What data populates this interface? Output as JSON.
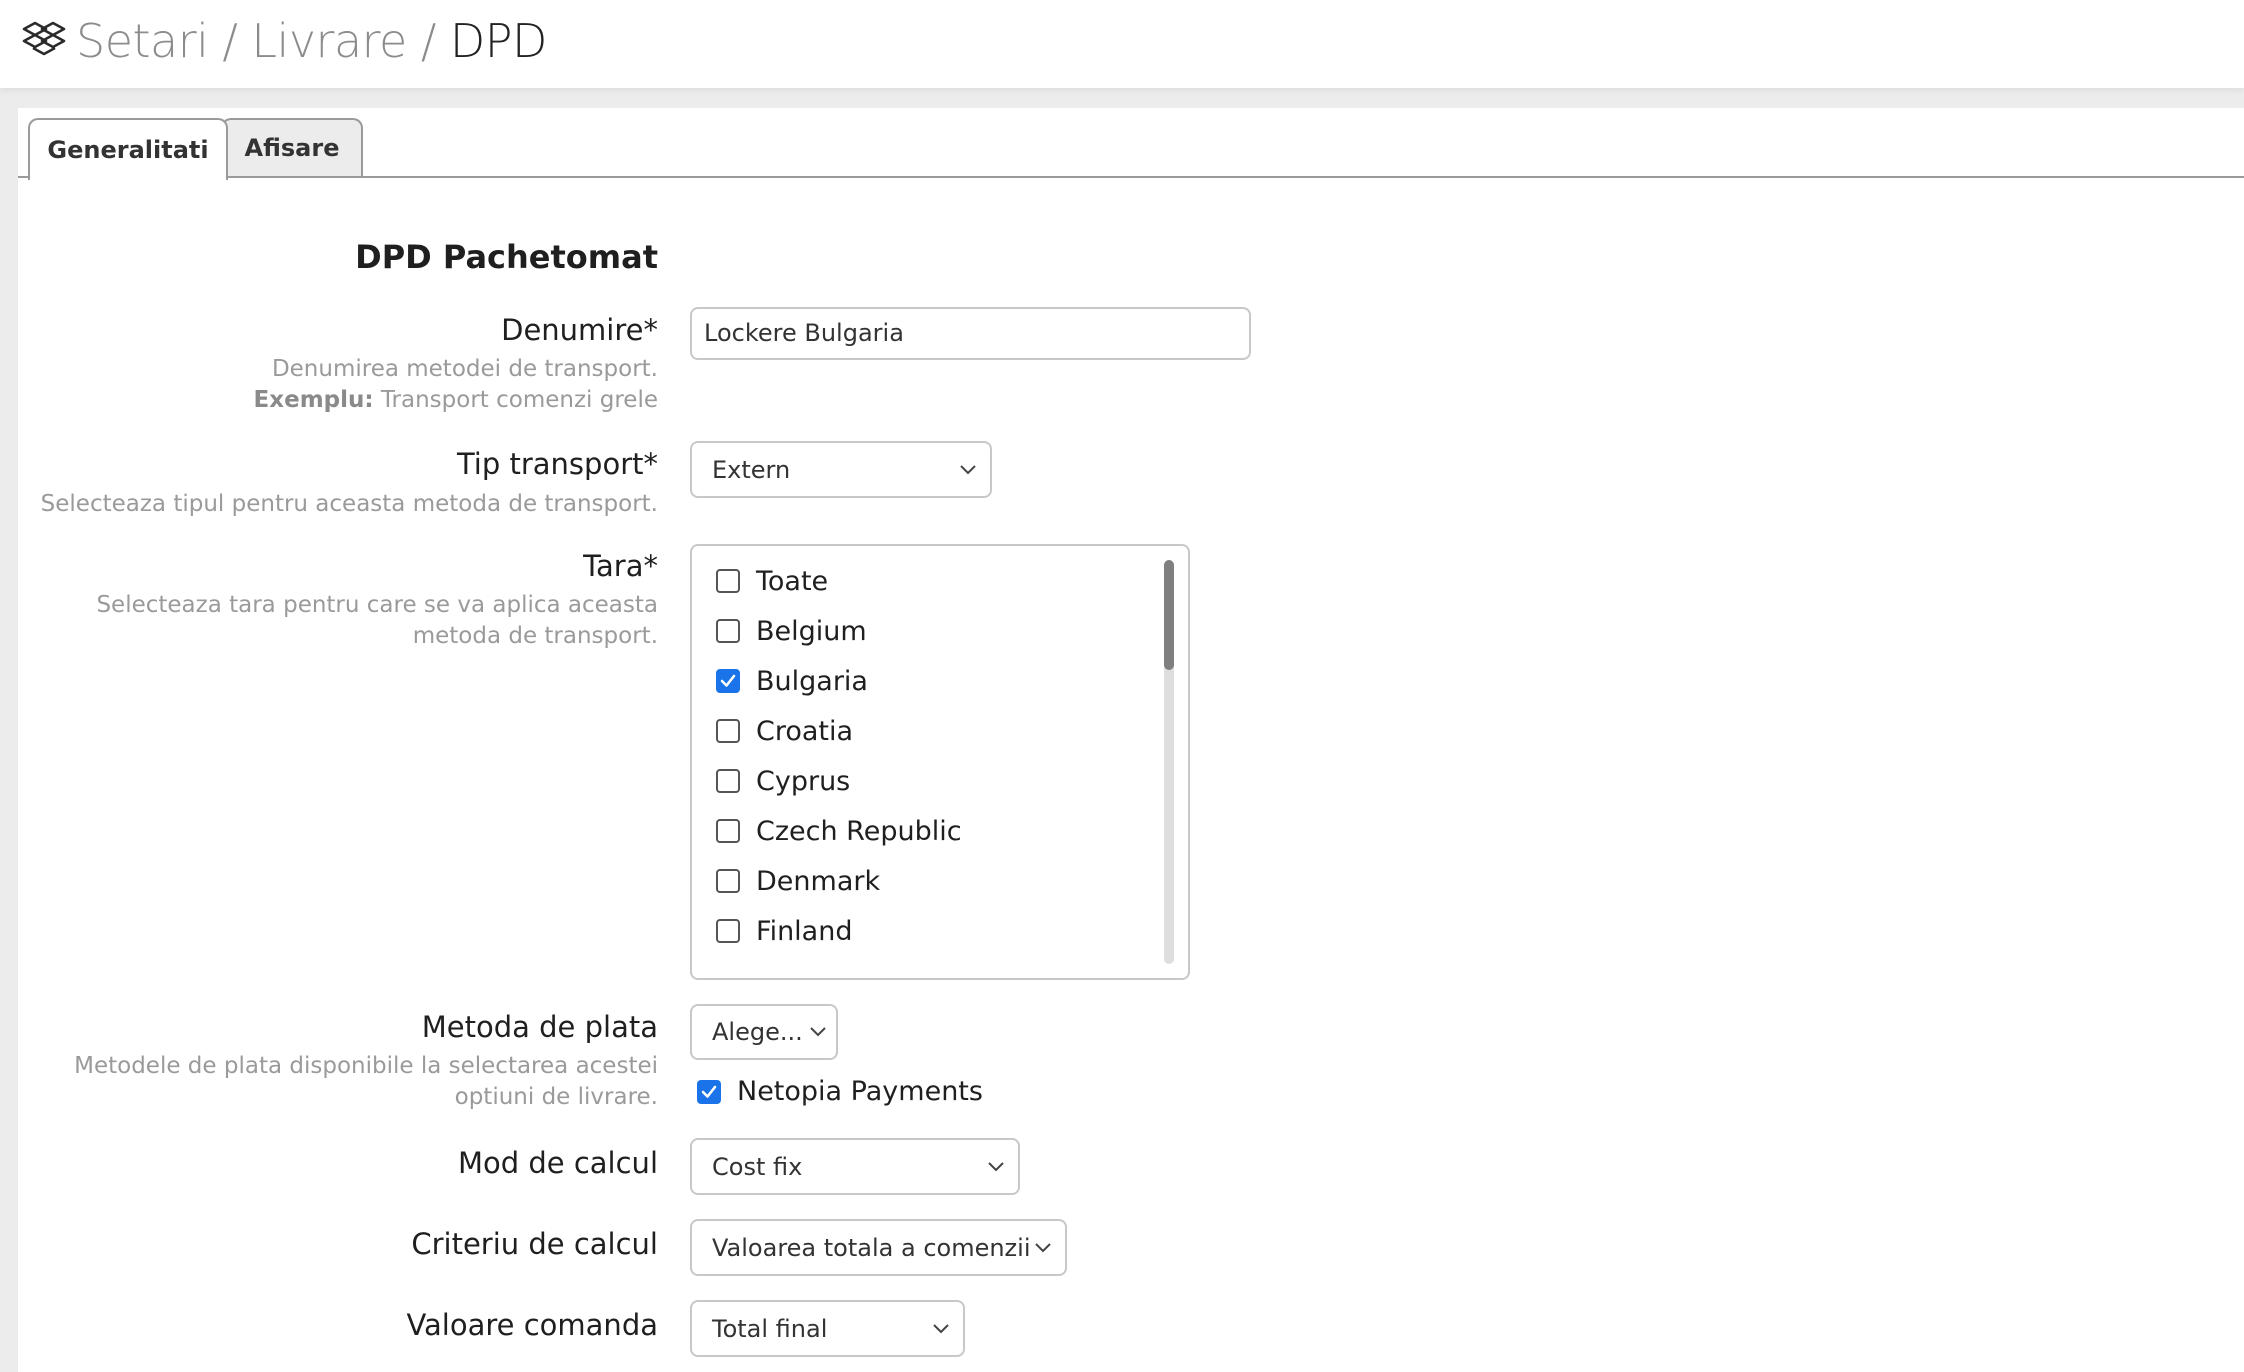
{
  "header": {
    "app_icon": "dropbox-like-boxes-icon",
    "breadcrumb": [
      "Setari",
      "Livrare",
      "DPD"
    ],
    "separator": "/"
  },
  "tabs": [
    {
      "label": "Generalitati",
      "active": true
    },
    {
      "label": "Afisare",
      "active": false
    }
  ],
  "form": {
    "section_title": "DPD Pachetomat",
    "denumire": {
      "label": "Denumire*",
      "value": "Lockere Bulgaria",
      "hint": "Denumirea metodei de transport.",
      "example_label": "Exemplu:",
      "example_text": " Transport comenzi grele"
    },
    "tip_transport": {
      "label": "Tip transport*",
      "value": "Extern",
      "hint": "Selecteaza tipul pentru aceasta metoda de transport."
    },
    "tara": {
      "label": "Tara*",
      "hint_line1": "Selecteaza tara pentru care se va aplica aceasta",
      "hint_line2": "metoda de transport.",
      "options": [
        {
          "label": "Toate",
          "checked": false
        },
        {
          "label": "Belgium",
          "checked": false
        },
        {
          "label": "Bulgaria",
          "checked": true
        },
        {
          "label": "Croatia",
          "checked": false
        },
        {
          "label": "Cyprus",
          "checked": false
        },
        {
          "label": "Czech Republic",
          "checked": false
        },
        {
          "label": "Denmark",
          "checked": false
        },
        {
          "label": "Finland",
          "checked": false
        }
      ]
    },
    "metoda_plata": {
      "label": "Metoda de plata",
      "value": "Alege...",
      "hint_line1": "Metodele de plata disponibile la selectarea acestei",
      "hint_line2": "optiuni de livrare.",
      "selected_method": {
        "label": "Netopia Payments",
        "checked": true
      }
    },
    "mod_calcul": {
      "label": "Mod de calcul",
      "value": "Cost fix"
    },
    "criteriu_calcul": {
      "label": "Criteriu de calcul",
      "value": "Valoarea totala a comenzii"
    },
    "valoare_comanda": {
      "label": "Valoare comanda",
      "value": "Total final"
    }
  },
  "colors": {
    "accent": "#1a73e8",
    "muted_text": "#9a9a9a",
    "border": "#c8c8c8"
  }
}
